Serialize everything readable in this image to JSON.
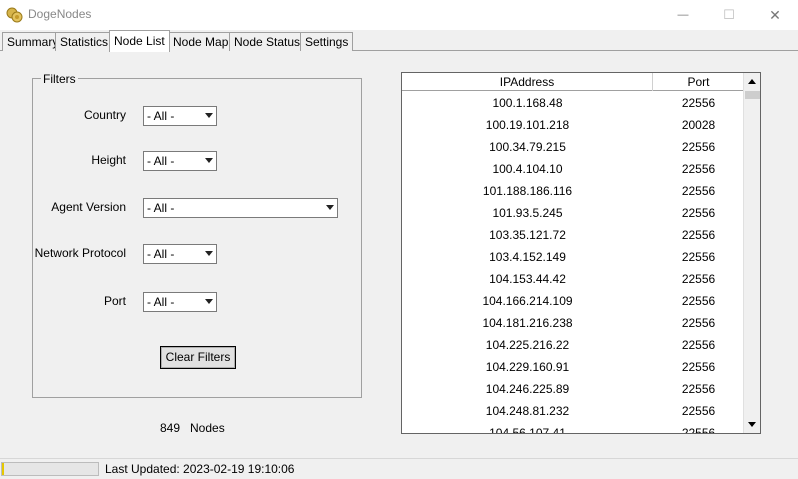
{
  "window": {
    "title": "DogeNodes",
    "controls": {
      "minimize": "—",
      "maximize": "☐",
      "close": "✕"
    }
  },
  "tabs": [
    {
      "label": "Summary",
      "active": false
    },
    {
      "label": "Statistics",
      "active": false
    },
    {
      "label": "Node List",
      "active": true
    },
    {
      "label": "Node Map",
      "active": false
    },
    {
      "label": "Node Status",
      "active": false
    },
    {
      "label": "Settings",
      "active": false
    }
  ],
  "filters": {
    "legend": "Filters",
    "country": {
      "label": "Country",
      "value": "- All -"
    },
    "height": {
      "label": "Height",
      "value": "- All -"
    },
    "agent_version": {
      "label": "Agent Version",
      "value": "- All -"
    },
    "network_protocol": {
      "label": "Network Protocol",
      "value": "- All -"
    },
    "port": {
      "label": "Port",
      "value": "- All -"
    },
    "clear_button": "Clear Filters"
  },
  "summary": {
    "count": "849",
    "unit": "Nodes"
  },
  "grid": {
    "columns": [
      "IPAddress",
      "Port"
    ],
    "rows": [
      [
        "100.1.168.48",
        "22556"
      ],
      [
        "100.19.101.218",
        "20028"
      ],
      [
        "100.34.79.215",
        "22556"
      ],
      [
        "100.4.104.10",
        "22556"
      ],
      [
        "101.188.186.116",
        "22556"
      ],
      [
        "101.93.5.245",
        "22556"
      ],
      [
        "103.35.121.72",
        "22556"
      ],
      [
        "103.4.152.149",
        "22556"
      ],
      [
        "104.153.44.42",
        "22556"
      ],
      [
        "104.166.214.109",
        "22556"
      ],
      [
        "104.181.216.238",
        "22556"
      ],
      [
        "104.225.216.22",
        "22556"
      ],
      [
        "104.229.160.91",
        "22556"
      ],
      [
        "104.246.225.89",
        "22556"
      ],
      [
        "104.248.81.232",
        "22556"
      ],
      [
        "104.56.107.41",
        "22556"
      ]
    ]
  },
  "status": {
    "progress": 0.02,
    "progress_color": "#e6c800",
    "last_updated": "Last Updated: 2023-02-19 19:10:06"
  },
  "icons": {
    "app": "doge-coin-icon"
  }
}
